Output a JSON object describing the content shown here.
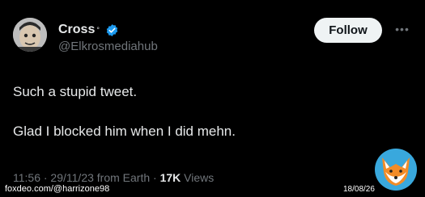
{
  "user": {
    "name": "Cross",
    "name_mark": "°",
    "handle": "@Elkrosmediahub"
  },
  "follow_label": "Follow",
  "more_label": "•••",
  "tweet": {
    "line1": "Such a stupid tweet.",
    "line2": "Glad I blocked him when I did mehn."
  },
  "meta": {
    "time_date": "11:56 · 29/11/23 from Earth · ",
    "views_count": "17K",
    "views_label": " Views"
  },
  "watermark": {
    "credit": "foxdeo.com/@harrizone98",
    "date": "18/08/26"
  },
  "colors": {
    "background": "#000000",
    "text": "#e7e9ea",
    "secondary": "#71767b",
    "verified": "#1d9bf0",
    "fox_badge": "#39a8dd"
  },
  "icons": [
    "avatar",
    "verified-badge-icon",
    "more-options-icon",
    "fox-logo-icon"
  ]
}
